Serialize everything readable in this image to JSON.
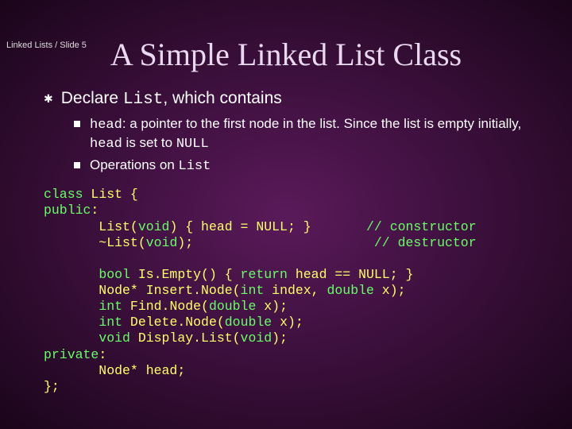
{
  "header": "Linked Lists / Slide 5",
  "title": "A Simple Linked List Class",
  "main_bullet": {
    "pre": "Declare ",
    "code": "List",
    "post": ", which contains"
  },
  "sub_bullets": [
    {
      "code1": "head",
      "mid": ": a pointer to the first node in the list. Since the list is empty initially, ",
      "code2": "head",
      "mid2": " is set to ",
      "code3": "NULL"
    },
    {
      "pre": "Operations on ",
      "code": "List"
    }
  ],
  "code": {
    "l1a": "class",
    "l1b": " List {",
    "l2": "public",
    "l2b": ":",
    "l3a": "       List(",
    "l3b": "void",
    "l3c": ") { head = NULL; }       ",
    "l3d": "// constructor",
    "l4a": "       ~List(",
    "l4b": "void",
    "l4c": ");                       ",
    "l4d": "// destructor",
    "blank": "",
    "l5a": "       ",
    "l5b": "bool",
    "l5c": " Is.Empty() { ",
    "l5d": "return",
    "l5e": " head == NULL; }",
    "l6a": "       Node* Insert.Node(",
    "l6b": "int",
    "l6c": " index, ",
    "l6d": "double",
    "l6e": " x);",
    "l7a": "       ",
    "l7b": "int",
    "l7c": " Find.Node(",
    "l7d": "double",
    "l7e": " x);",
    "l8a": "       ",
    "l8b": "int",
    "l8c": " Delete.Node(",
    "l8d": "double",
    "l8e": " x);",
    "l9a": "       ",
    "l9b": "void",
    "l9c": " Display.List(",
    "l9d": "void",
    "l9e": ");",
    "l10": "private",
    "l10b": ":",
    "l11": "       Node* head;",
    "l12": "};"
  }
}
